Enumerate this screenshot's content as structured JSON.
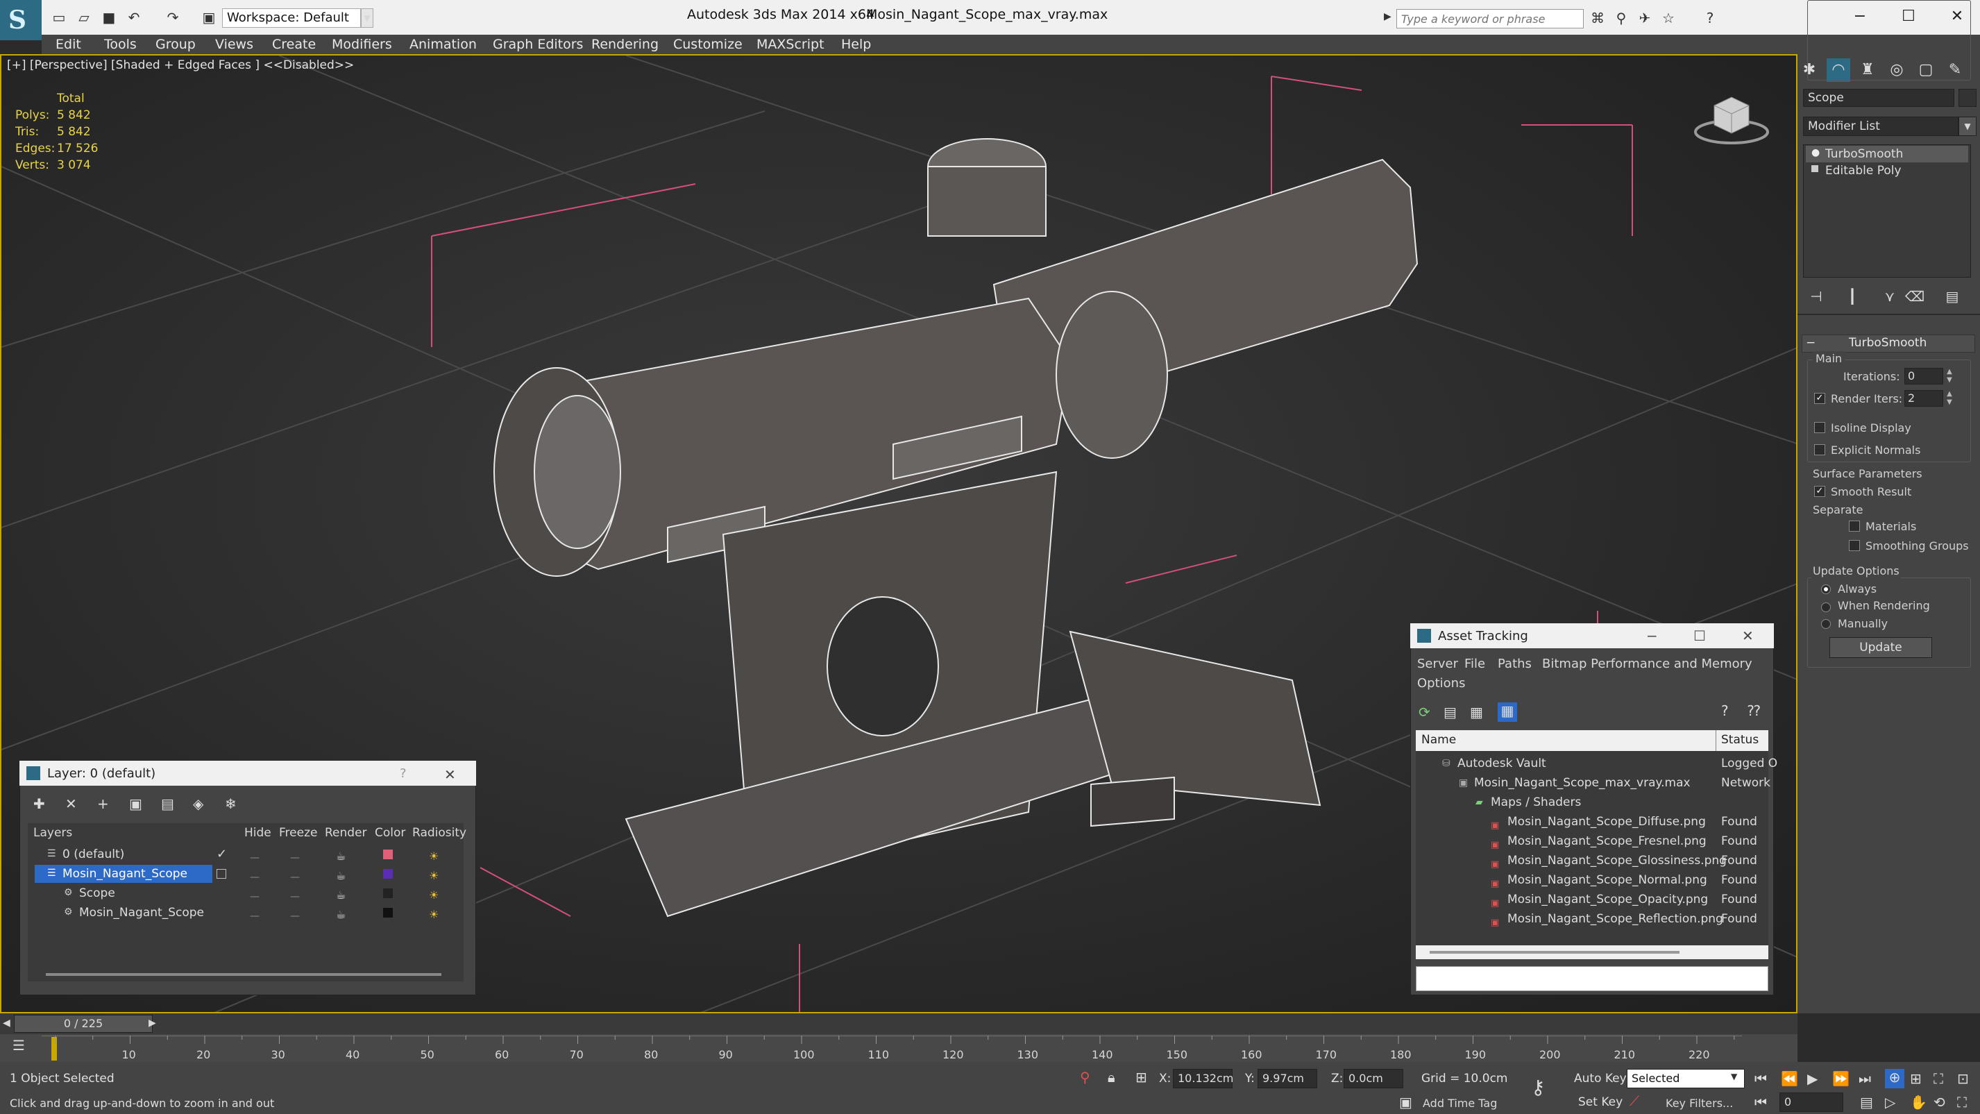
{
  "app": {
    "title": "Autodesk 3ds Max  2014 x64",
    "file": "Mosin_Nagant_Scope_max_vray.max",
    "workspace": "Workspace: Default",
    "search_placeholder": "Type a keyword or phrase"
  },
  "menu": [
    "Edit",
    "Tools",
    "Group",
    "Views",
    "Create",
    "Modifiers",
    "Animation",
    "Graph Editors",
    "Rendering",
    "Customize",
    "MAXScript",
    "Help"
  ],
  "viewport": {
    "label": "[+] [Perspective] [Shaded + Edged Faces ]  <<Disabled>>",
    "stats_header": "Total",
    "stats": [
      {
        "k": "Polys:",
        "v": "5 842"
      },
      {
        "k": "Tris:",
        "v": "5 842"
      },
      {
        "k": "Edges:",
        "v": "17 526"
      },
      {
        "k": "Verts:",
        "v": "3 074"
      }
    ]
  },
  "command_panel": {
    "object_name": "Scope",
    "modifier_list": "Modifier List",
    "stack": [
      "TurboSmooth",
      "Editable Poly"
    ],
    "rollout_title": "TurboSmooth",
    "main_label": "Main",
    "iterations_label": "Iterations:",
    "iterations_value": "0",
    "render_iters_label": "Render Iters:",
    "render_iters_value": "2",
    "isoline": "Isoline Display",
    "explicit_normals": "Explicit Normals",
    "surface_params": "Surface Parameters",
    "smooth_result": "Smooth Result",
    "separate": "Separate",
    "materials": "Materials",
    "smoothing_groups": "Smoothing Groups",
    "update_options": "Update Options",
    "always": "Always",
    "when_rendering": "When Rendering",
    "manually": "Manually",
    "update_btn": "Update"
  },
  "layer_window": {
    "title": "Layer: 0 (default)",
    "help": "?",
    "close": "✕",
    "columns": [
      "Layers",
      "Hide",
      "Freeze",
      "Render",
      "Color",
      "Radiosity"
    ],
    "rows": [
      {
        "name": "0 (default)",
        "color": "#e0607a",
        "check": "✓"
      },
      {
        "name": "Mosin_Nagant_Scope",
        "color": "#5a2db4",
        "check": ""
      },
      {
        "name": "Scope",
        "color": "#222222",
        "check": ""
      },
      {
        "name": "Mosin_Nagant_Scope",
        "color": "#111111",
        "check": ""
      }
    ]
  },
  "asset_window": {
    "title": "Asset Tracking",
    "menu": [
      "Server",
      "File",
      "Paths",
      "Bitmap Performance and Memory"
    ],
    "menu2": "Options",
    "columns": [
      "Name",
      "Status"
    ],
    "rows": [
      {
        "name": "Autodesk Vault",
        "status": "Logged O"
      },
      {
        "name": "Mosin_Nagant_Scope_max_vray.max",
        "status": "Network"
      },
      {
        "name": "Maps / Shaders",
        "status": ""
      },
      {
        "name": "Mosin_Nagant_Scope_Diffuse.png",
        "status": "Found"
      },
      {
        "name": "Mosin_Nagant_Scope_Fresnel.png",
        "status": "Found"
      },
      {
        "name": "Mosin_Nagant_Scope_Glossiness.png",
        "status": "Found"
      },
      {
        "name": "Mosin_Nagant_Scope_Normal.png",
        "status": "Found"
      },
      {
        "name": "Mosin_Nagant_Scope_Opacity.png",
        "status": "Found"
      },
      {
        "name": "Mosin_Nagant_Scope_Reflection.png",
        "status": "Found"
      }
    ]
  },
  "timeline": {
    "frame": "0 / 225",
    "ticks": [
      "10",
      "20",
      "30",
      "40",
      "50",
      "60",
      "70",
      "80",
      "90",
      "100",
      "110",
      "120",
      "130",
      "140",
      "150",
      "160",
      "170",
      "180",
      "190",
      "200",
      "210",
      "220"
    ]
  },
  "status": {
    "selection": "1 Object Selected",
    "hint": "Click and drag up-and-down to zoom in and out",
    "x_label": "X:",
    "x_value": "10.132cm",
    "y_label": "Y:",
    "y_value": "9.97cm",
    "z_label": "Z:",
    "z_value": "0.0cm",
    "grid": "Grid = 10.0cm",
    "add_time_tag": "Add Time Tag",
    "auto_key": "Auto Key",
    "selected": "Selected",
    "set_key": "Set Key",
    "key_filters": "Key Filters...",
    "frame_field": "0"
  }
}
